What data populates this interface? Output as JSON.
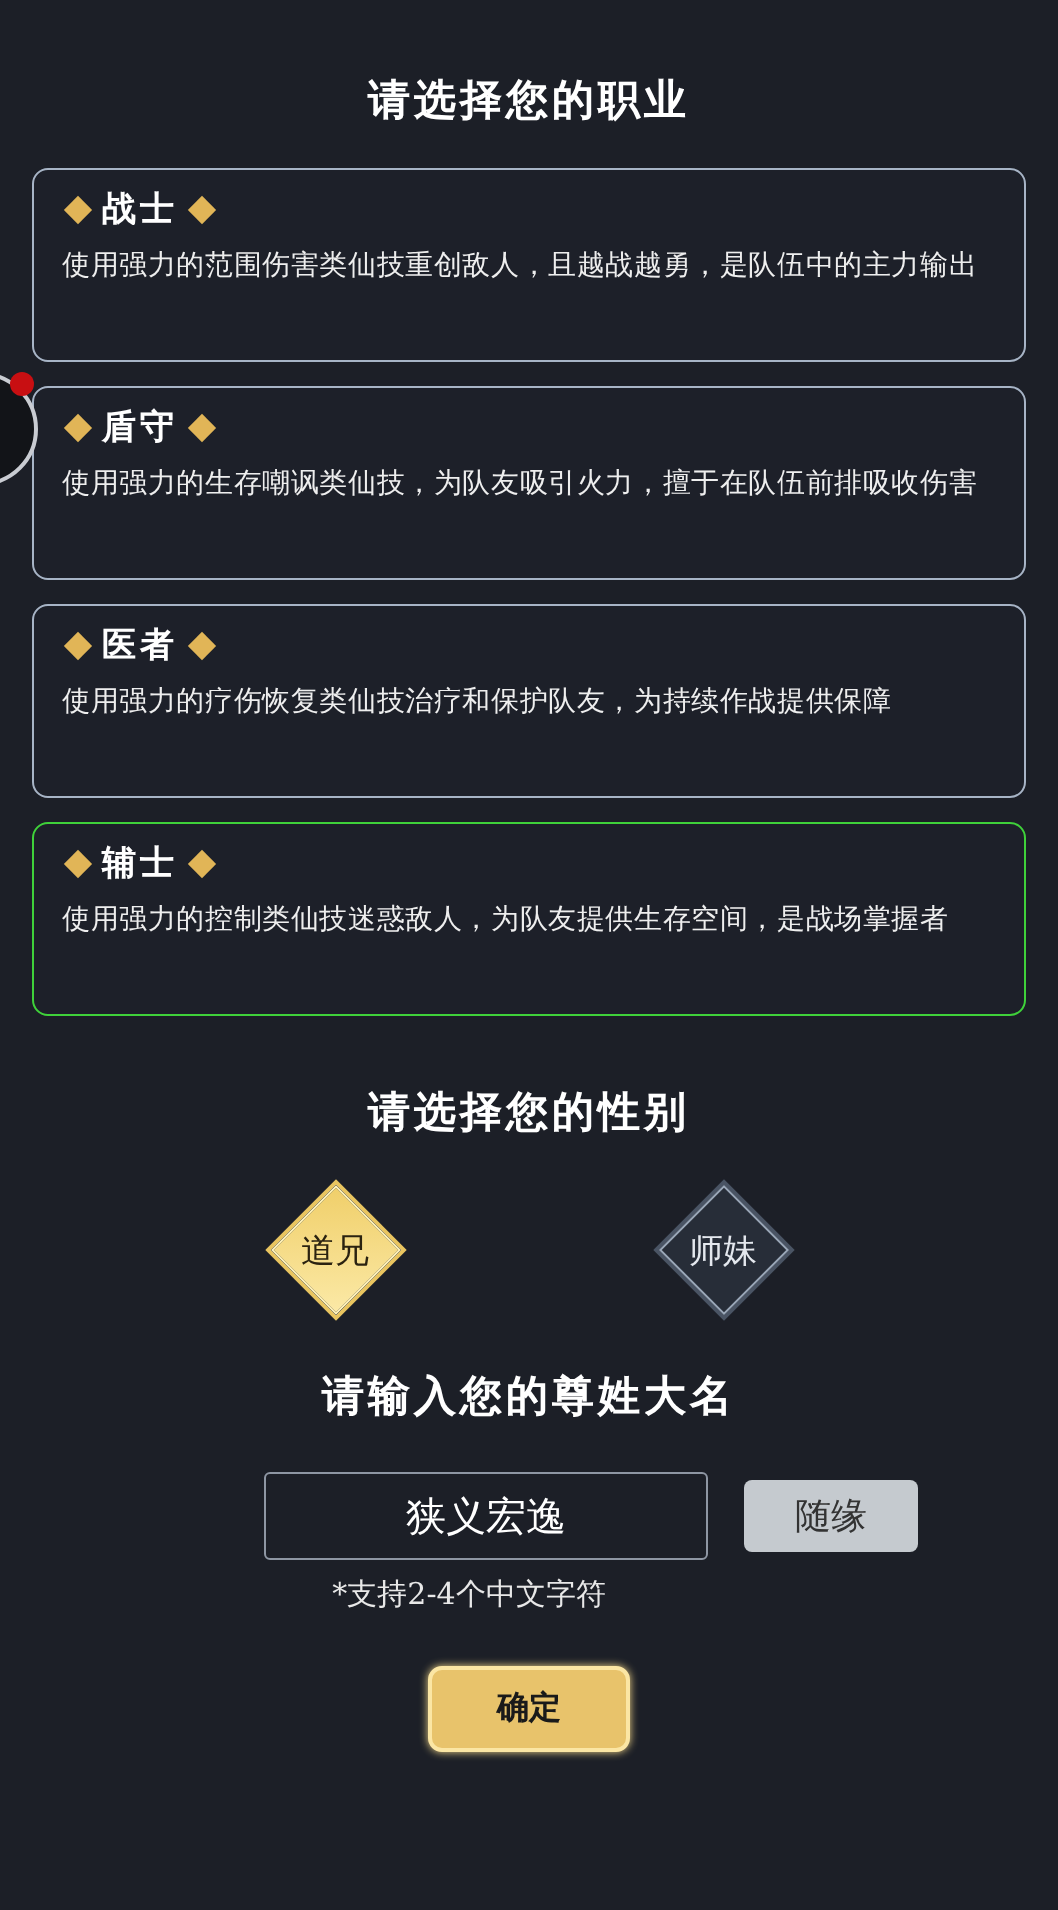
{
  "class_section": {
    "title": "请选择您的职业",
    "classes": [
      {
        "name": "战士",
        "description": "使用强力的范围伤害类仙技重创敌人，且越战越勇，是队伍中的主力输出",
        "selected": false
      },
      {
        "name": "盾守",
        "description": "使用强力的生存嘲讽类仙技，为队友吸引火力，擅于在队伍前排吸收伤害",
        "selected": false
      },
      {
        "name": "医者",
        "description": "使用强力的疗伤恢复类仙技治疗和保护队友，为持续作战提供保障",
        "selected": false
      },
      {
        "name": "辅士",
        "description": "使用强力的控制类仙技迷惑敌人，为队友提供生存空间，是战场掌握者",
        "selected": true
      }
    ]
  },
  "gender_section": {
    "title": "请选择您的性别",
    "options": [
      {
        "label": "道兄",
        "selected": true
      },
      {
        "label": "师妹",
        "selected": false
      }
    ]
  },
  "name_section": {
    "title": "请输入您的尊姓大名",
    "value": "狭义宏逸",
    "random_button": "随缘",
    "hint": "*支持2-4个中文字符"
  },
  "confirm_button": "确定"
}
